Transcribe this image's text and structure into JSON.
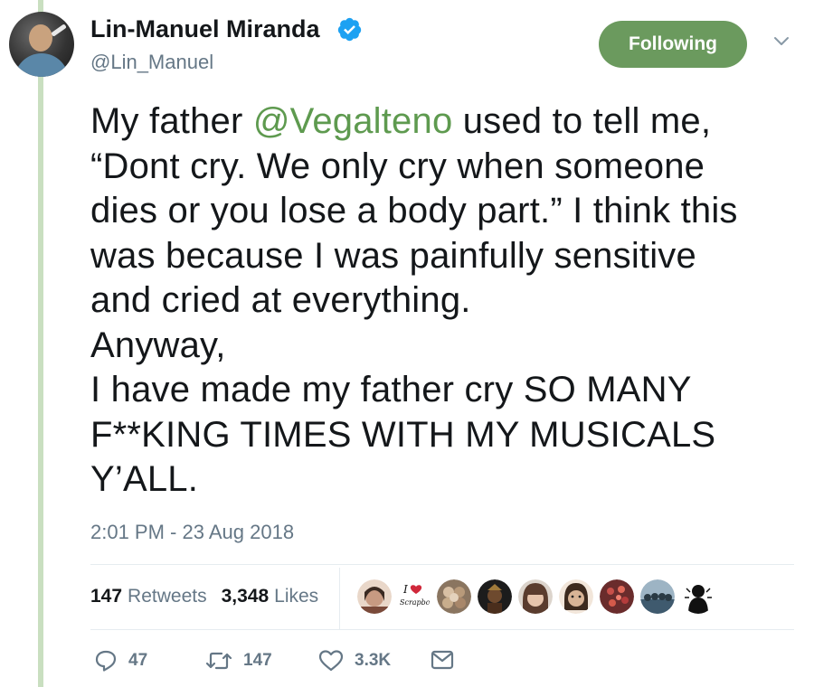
{
  "author": {
    "name": "Lin-Manuel Miranda",
    "handle": "@Lin_Manuel",
    "verified": true,
    "avatar_icon": "profile-photo"
  },
  "follow_button": {
    "label": "Following",
    "color": "#6b9a5e"
  },
  "menu_icon": "chevron-down-icon",
  "tweet": {
    "text_before_mention": "My father ",
    "mention": "@Vegalteno",
    "text_after_mention": " used to tell me,",
    "lines": [
      "“Dont cry. We only cry when someone",
      "dies or you lose a body part.” I think this",
      "was because I was painfully sensitive",
      "and cried at everything.",
      "Anyway,",
      "I have made my father cry SO MANY",
      "F**KING TIMES WITH MY MUSICALS",
      "Y’ALL."
    ],
    "mention_color": "#5e9a4f"
  },
  "timestamp": "2:01 PM - 23 Aug 2018",
  "stats": {
    "retweets": {
      "count": "147",
      "label": "Retweets"
    },
    "likes": {
      "count": "3,348",
      "label": "Likes"
    }
  },
  "likers": [
    {
      "icon": "user-avatar",
      "color": "#c79a82"
    },
    {
      "icon": "i-love-scrapbooking-avatar",
      "color": "#ffffff"
    },
    {
      "icon": "user-avatar",
      "color": "#8a7560"
    },
    {
      "icon": "user-avatar",
      "color": "#1c1c1c"
    },
    {
      "icon": "user-avatar",
      "color": "#9a8270"
    },
    {
      "icon": "user-avatar",
      "color": "#d8b496"
    },
    {
      "icon": "user-avatar",
      "color": "#6a2c2c"
    },
    {
      "icon": "user-avatar",
      "color": "#3f5a6e"
    },
    {
      "icon": "user-avatar",
      "color": "#111111"
    }
  ],
  "actions": {
    "reply": {
      "icon": "reply-icon",
      "count": "47"
    },
    "retweet": {
      "icon": "retweet-icon",
      "count": "147"
    },
    "like": {
      "icon": "heart-icon",
      "count": "3.3K"
    },
    "message": {
      "icon": "envelope-icon"
    }
  },
  "colors": {
    "secondary_text": "#657786",
    "thread_line": "#c9dfc0"
  }
}
